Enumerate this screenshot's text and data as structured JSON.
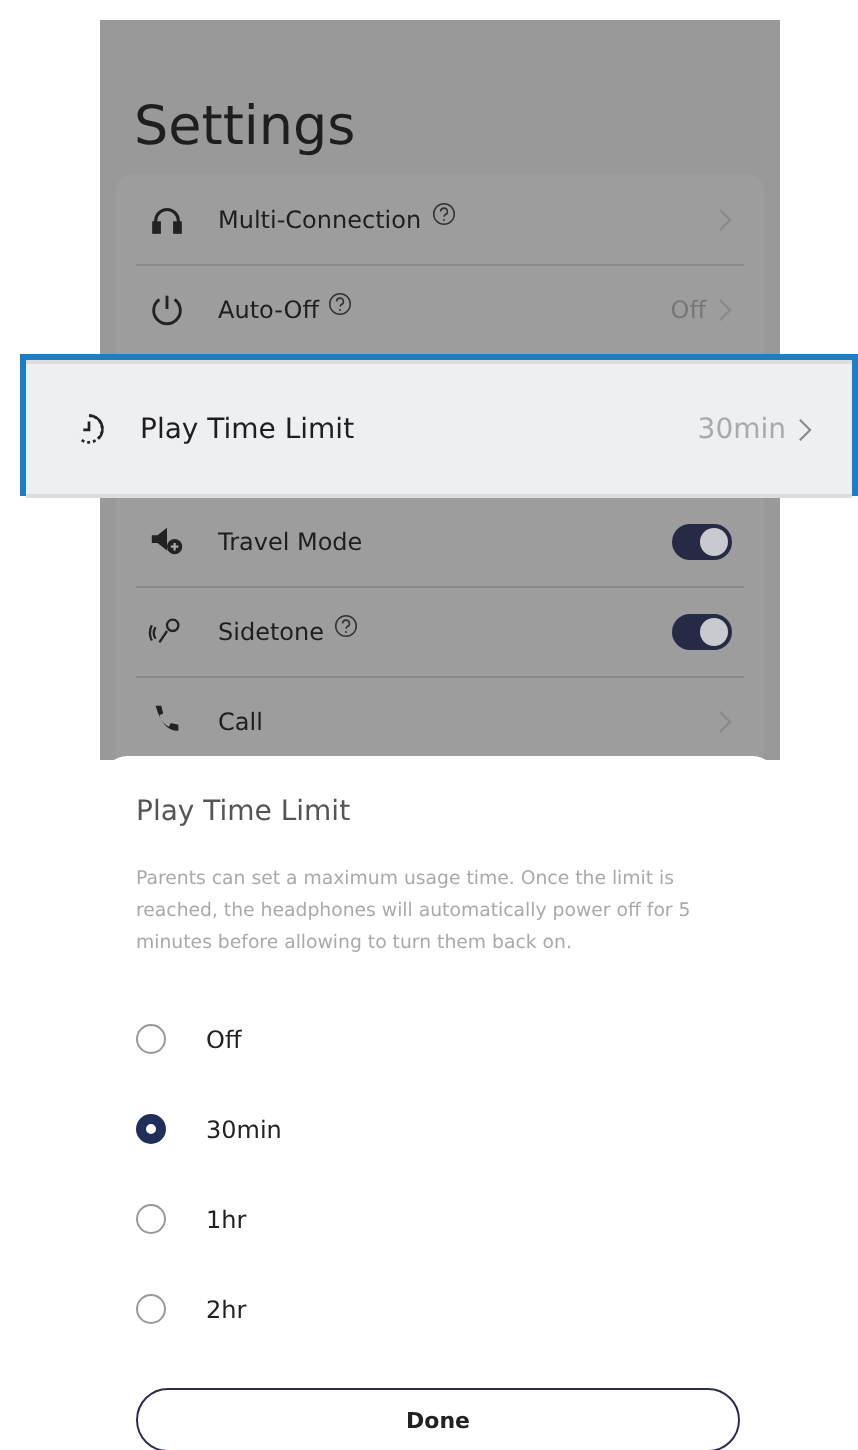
{
  "header": {
    "title": "Settings"
  },
  "rows": [
    {
      "label": "Multi-Connection",
      "kind": "link",
      "help": true,
      "value": "",
      "selected": false
    },
    {
      "label": "Auto-Off",
      "kind": "link",
      "help": true,
      "value": "Off",
      "selected": false
    },
    {
      "label": "Play Time Limit",
      "kind": "link",
      "help": false,
      "value": "30min",
      "selected": true
    },
    {
      "label": "Travel Mode",
      "kind": "toggle",
      "help": false,
      "on": true,
      "selected": false
    },
    {
      "label": "Sidetone",
      "kind": "toggle",
      "help": true,
      "on": true,
      "selected": false
    },
    {
      "label": "Call",
      "kind": "link",
      "help": false,
      "value": "",
      "selected": false
    }
  ],
  "sheet": {
    "title": "Play Time Limit",
    "description": "Parents can set a maximum usage time. Once the limit is reached, the headphones will automatically power off for 5 minutes before allowing to turn them back on.",
    "options": [
      {
        "label": "Off",
        "selected": false
      },
      {
        "label": "30min",
        "selected": true
      },
      {
        "label": "1hr",
        "selected": false
      },
      {
        "label": "2hr",
        "selected": false
      }
    ],
    "button": "Done"
  }
}
